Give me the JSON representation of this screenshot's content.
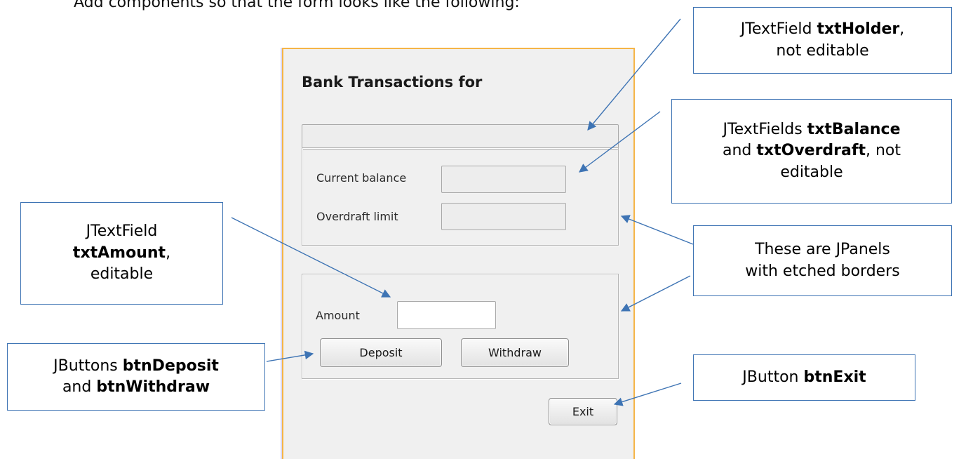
{
  "intro_text": "Add components so that the form looks like the following:",
  "form": {
    "title": "Bank Transactions for",
    "holder_value": "",
    "balance_panel": {
      "current_balance_label": "Current balance",
      "current_balance_value": "",
      "overdraft_label": "Overdraft limit",
      "overdraft_value": ""
    },
    "amount_panel": {
      "amount_label": "Amount",
      "amount_value": "",
      "deposit_label": "Deposit",
      "withdraw_label": "Withdraw"
    },
    "exit_label": "Exit"
  },
  "callouts": {
    "holder": {
      "pre": "JTextField ",
      "name": "txtHolder",
      "post": ",",
      "line2": "not editable"
    },
    "balance": {
      "pre": "JTextFields ",
      "name1": "txtBalance",
      "mid": "and ",
      "name2": "txtOverdraft",
      "post": ", not",
      "line3": "editable"
    },
    "amount": {
      "line1": "JTextField",
      "name": "txtAmount",
      "post": ",",
      "line3": "editable"
    },
    "panels": {
      "line1": "These are JPanels",
      "line2": "with etched borders"
    },
    "buttons": {
      "pre": "JButtons ",
      "name1": "btnDeposit",
      "mid": "and ",
      "name2": "btnWithdraw"
    },
    "exit": {
      "pre": "JButton ",
      "name": "btnExit"
    }
  },
  "colors": {
    "callout_border": "#3e74b4",
    "form_border": "#f5b547",
    "form_background": "#f0f0f0"
  }
}
